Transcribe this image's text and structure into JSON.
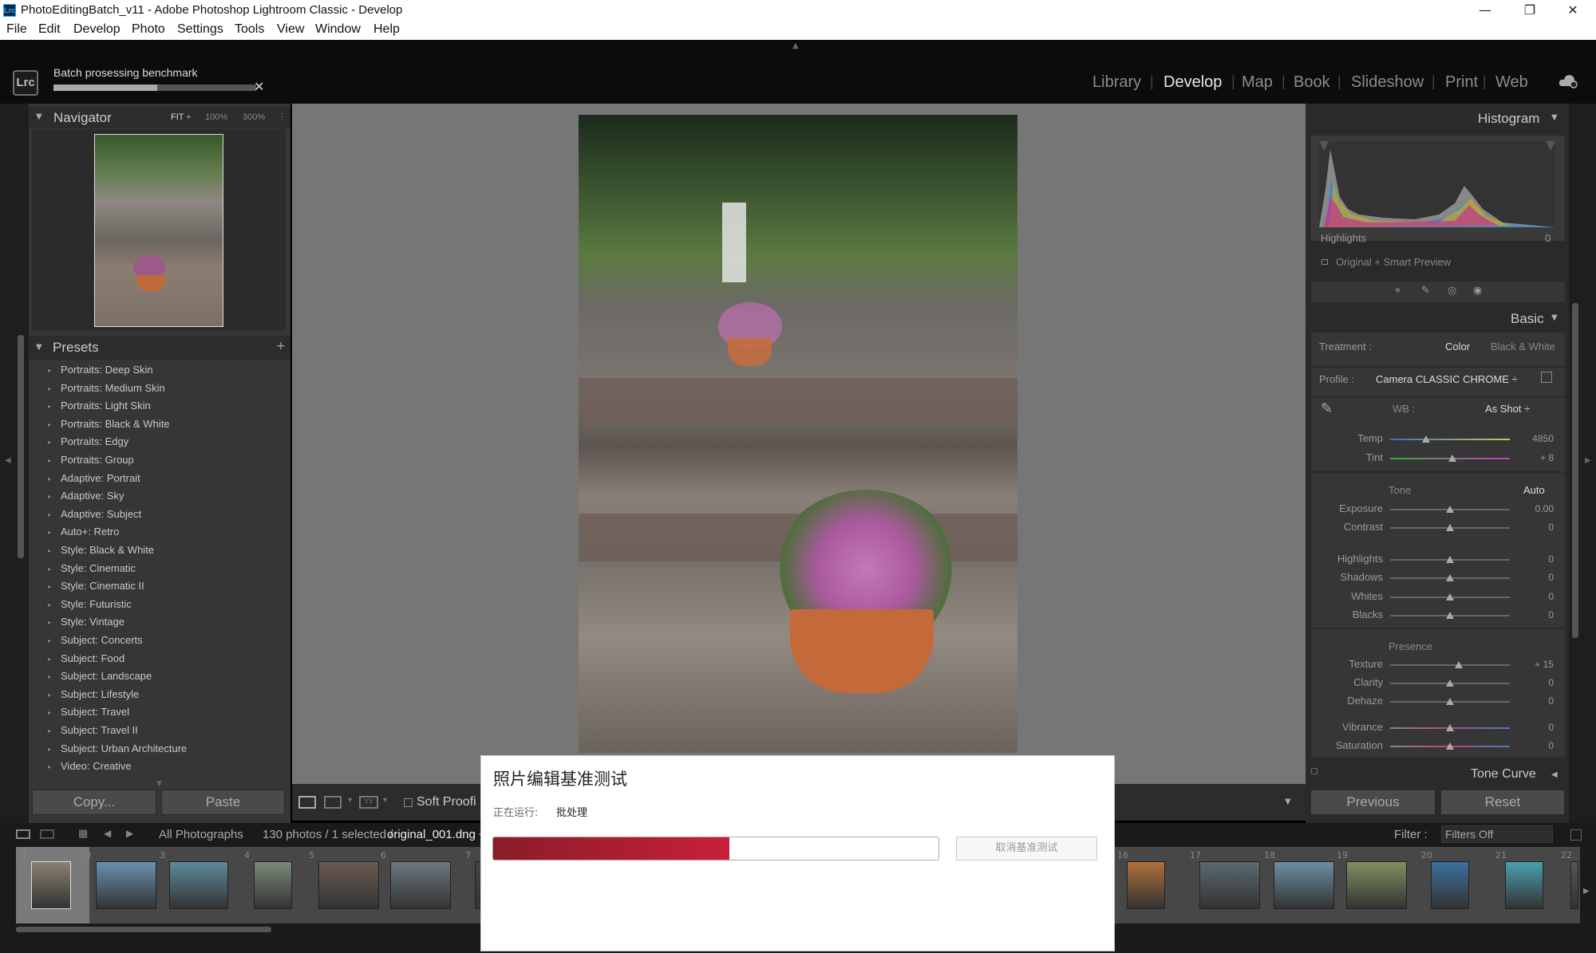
{
  "window": {
    "title": "PhotoEditingBatch_v11 - Adobe Photoshop Lightroom Classic - Develop",
    "app_icon": "Lrc"
  },
  "menu": [
    "File",
    "Edit",
    "Develop",
    "Photo",
    "Settings",
    "Tools",
    "View",
    "Window",
    "Help"
  ],
  "identity": {
    "logo": "Lrc",
    "task": "Batch prosessing benchmark",
    "task_progress": 0.51
  },
  "modules": [
    "Library",
    "Develop",
    "Map",
    "Book",
    "Slideshow",
    "Print",
    "Web"
  ],
  "active_module": "Develop",
  "navigator": {
    "title": "Navigator",
    "zoom": [
      "FIT ÷",
      "100%",
      "300%"
    ]
  },
  "presets": {
    "title": "Presets",
    "items": [
      "Portraits: Deep Skin",
      "Portraits: Medium Skin",
      "Portraits: Light Skin",
      "Portraits: Black & White",
      "Portraits: Edgy",
      "Portraits: Group",
      "Adaptive: Portrait",
      "Adaptive: Sky",
      "Adaptive: Subject",
      "Auto+: Retro",
      "Style: Black & White",
      "Style: Cinematic",
      "Style: Cinematic II",
      "Style: Futuristic",
      "Style: Vintage",
      "Subject: Concerts",
      "Subject: Food",
      "Subject: Landscape",
      "Subject: Lifestyle",
      "Subject: Travel",
      "Subject: Travel II",
      "Subject: Urban Architecture",
      "Video: Creative"
    ]
  },
  "left_buttons": {
    "copy": "Copy...",
    "paste": "Paste"
  },
  "toolbar": {
    "soft_proofing": "Soft Proofi"
  },
  "histogram": {
    "title": "Histogram",
    "label": "Highlights",
    "value": "0",
    "preview": "Original + Smart Preview"
  },
  "basic": {
    "title": "Basic",
    "treatment_label": "Treatment :",
    "treatment_color": "Color",
    "treatment_bw": "Black & White",
    "profile_label": "Profile :",
    "profile_value": "Camera CLASSIC CHROME ÷",
    "wb_label": "WB :",
    "wb_value": "As Shot ÷",
    "temp": {
      "label": "Temp",
      "value": "4850",
      "pos": 0.3
    },
    "tint": {
      "label": "Tint",
      "value": "+ 8",
      "pos": 0.52
    },
    "tone_label": "Tone",
    "auto": "Auto",
    "tone_sliders": [
      {
        "label": "Exposure",
        "value": "0.00",
        "pos": 0.5
      },
      {
        "label": "Contrast",
        "value": "0",
        "pos": 0.5
      },
      {
        "label": "Highlights",
        "value": "0",
        "pos": 0.5
      },
      {
        "label": "Shadows",
        "value": "0",
        "pos": 0.5
      },
      {
        "label": "Whites",
        "value": "0",
        "pos": 0.5
      },
      {
        "label": "Blacks",
        "value": "0",
        "pos": 0.5
      }
    ],
    "presence_label": "Presence",
    "presence_sliders": [
      {
        "label": "Texture",
        "value": "+ 15",
        "pos": 0.57
      },
      {
        "label": "Clarity",
        "value": "0",
        "pos": 0.5
      },
      {
        "label": "Dehaze",
        "value": "0",
        "pos": 0.5
      },
      {
        "label": "Vibrance",
        "value": "0",
        "pos": 0.5
      },
      {
        "label": "Saturation",
        "value": "0",
        "pos": 0.5
      }
    ],
    "tone_curve": "Tone Curve"
  },
  "right_buttons": {
    "previous": "Previous",
    "reset": "Reset"
  },
  "filmstrip": {
    "source": "All Photographs",
    "count": "130 photos / 1 selected /",
    "file": "original_001.dng ÷",
    "filter_label": "Filter :",
    "filter_value": "Filters Off",
    "numbers": [
      "1",
      "2",
      "3",
      "4",
      "5",
      "6",
      "7",
      "16",
      "17",
      "18",
      "19",
      "20",
      "21",
      "22"
    ]
  },
  "dialog": {
    "title": "照片编辑基准测试",
    "status_label": "正在运行:",
    "status_value": "批处理",
    "progress": 0.53,
    "cancel": "取消基准测试"
  }
}
